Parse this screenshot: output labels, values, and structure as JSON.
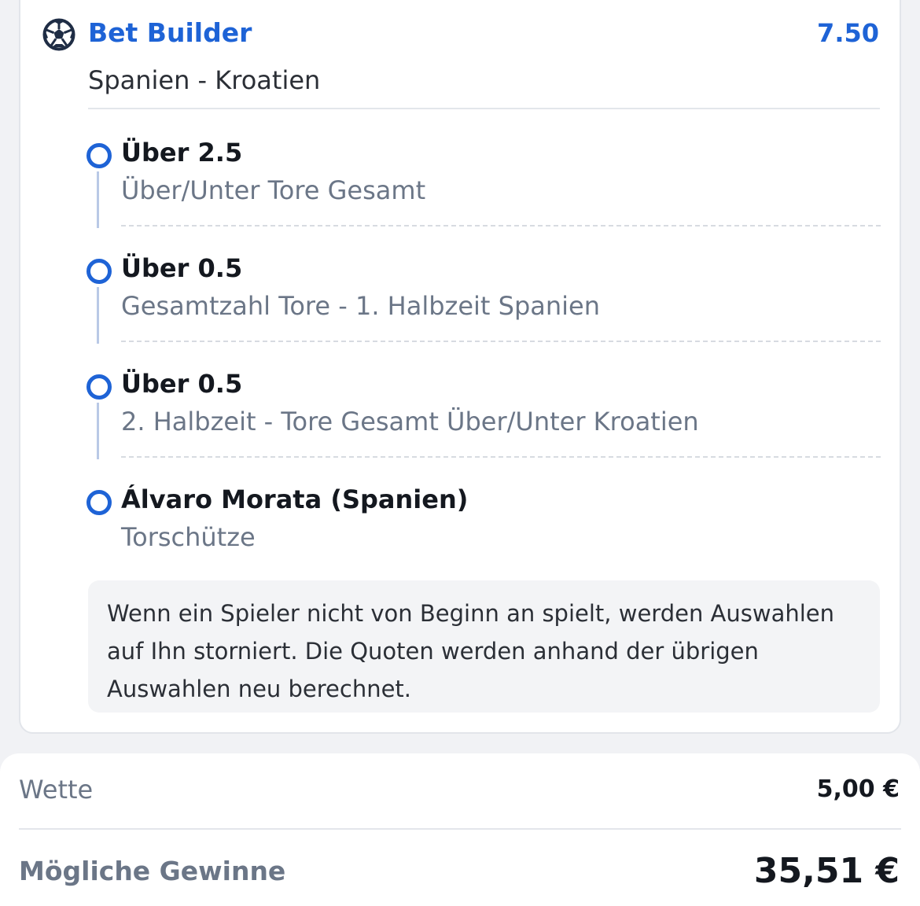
{
  "bet": {
    "type_label": "Bet Builder",
    "odds": "7.50",
    "event": "Spanien - Kroatien",
    "icon": "soccer-ball-icon",
    "accent_color": "#1e63d6",
    "legs": [
      {
        "selection": "Über 2.5",
        "market": "Über/Unter Tore Gesamt"
      },
      {
        "selection": "Über 0.5",
        "market": "Gesamtzahl Tore - 1. Halbzeit Spanien"
      },
      {
        "selection": "Über 0.5",
        "market": "2. Halbzeit - Tore Gesamt Über/Unter Kroatien"
      },
      {
        "selection": "Álvaro Morata (Spanien)",
        "market": "Torschütze"
      }
    ],
    "info_note": "Wenn ein Spieler nicht von Beginn an spielt, werden Auswahlen auf Ihn storniert. Die Quoten werden anhand der übrigen Auswahlen neu berechnet."
  },
  "summary": {
    "stake_label": "Wette",
    "stake_value": "5,00 €",
    "payout_label": "Mögliche Gewinne",
    "payout_value": "35,51 €"
  }
}
